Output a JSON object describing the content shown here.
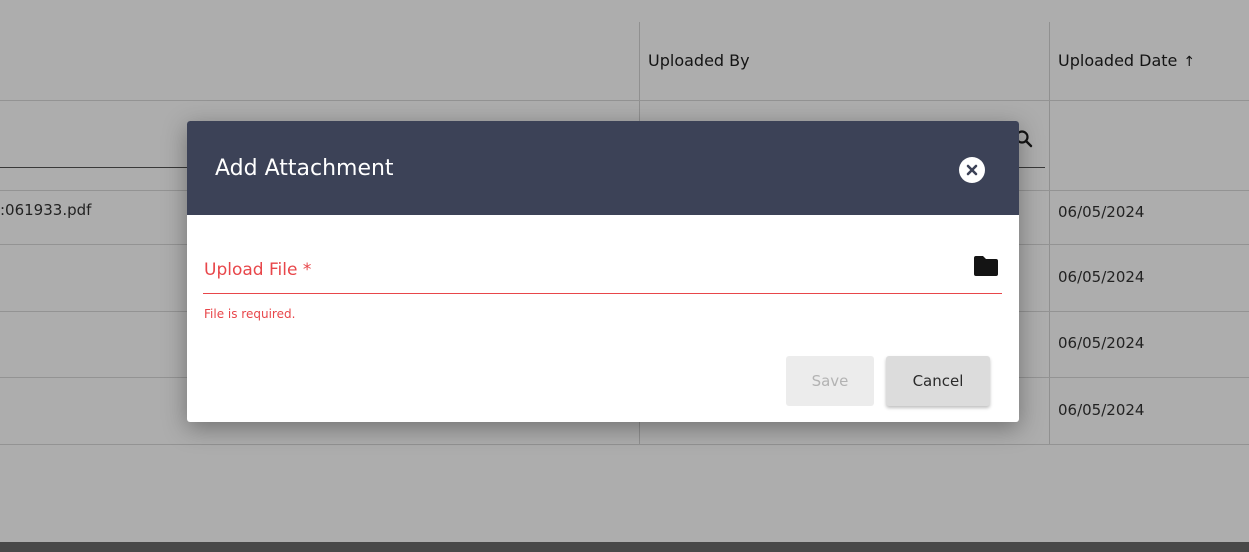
{
  "table": {
    "headers": {
      "uploaded_by": "Uploaded By",
      "uploaded_date": "Uploaded Date"
    },
    "sort_indicator": "↑",
    "rows": [
      {
        "file": ":061933.pdf",
        "date": "06/05/2024"
      },
      {
        "file": "",
        "date": "06/05/2024"
      },
      {
        "file": "",
        "date": "06/05/2024"
      },
      {
        "file": "",
        "date": "06/05/2024"
      }
    ]
  },
  "dialog": {
    "title": "Add Attachment",
    "upload_label": "Upload File *",
    "error": "File is required.",
    "save_label": "Save",
    "cancel_label": "Cancel"
  },
  "colors": {
    "header_bg": "#3c4257",
    "error": "#e8464a"
  }
}
